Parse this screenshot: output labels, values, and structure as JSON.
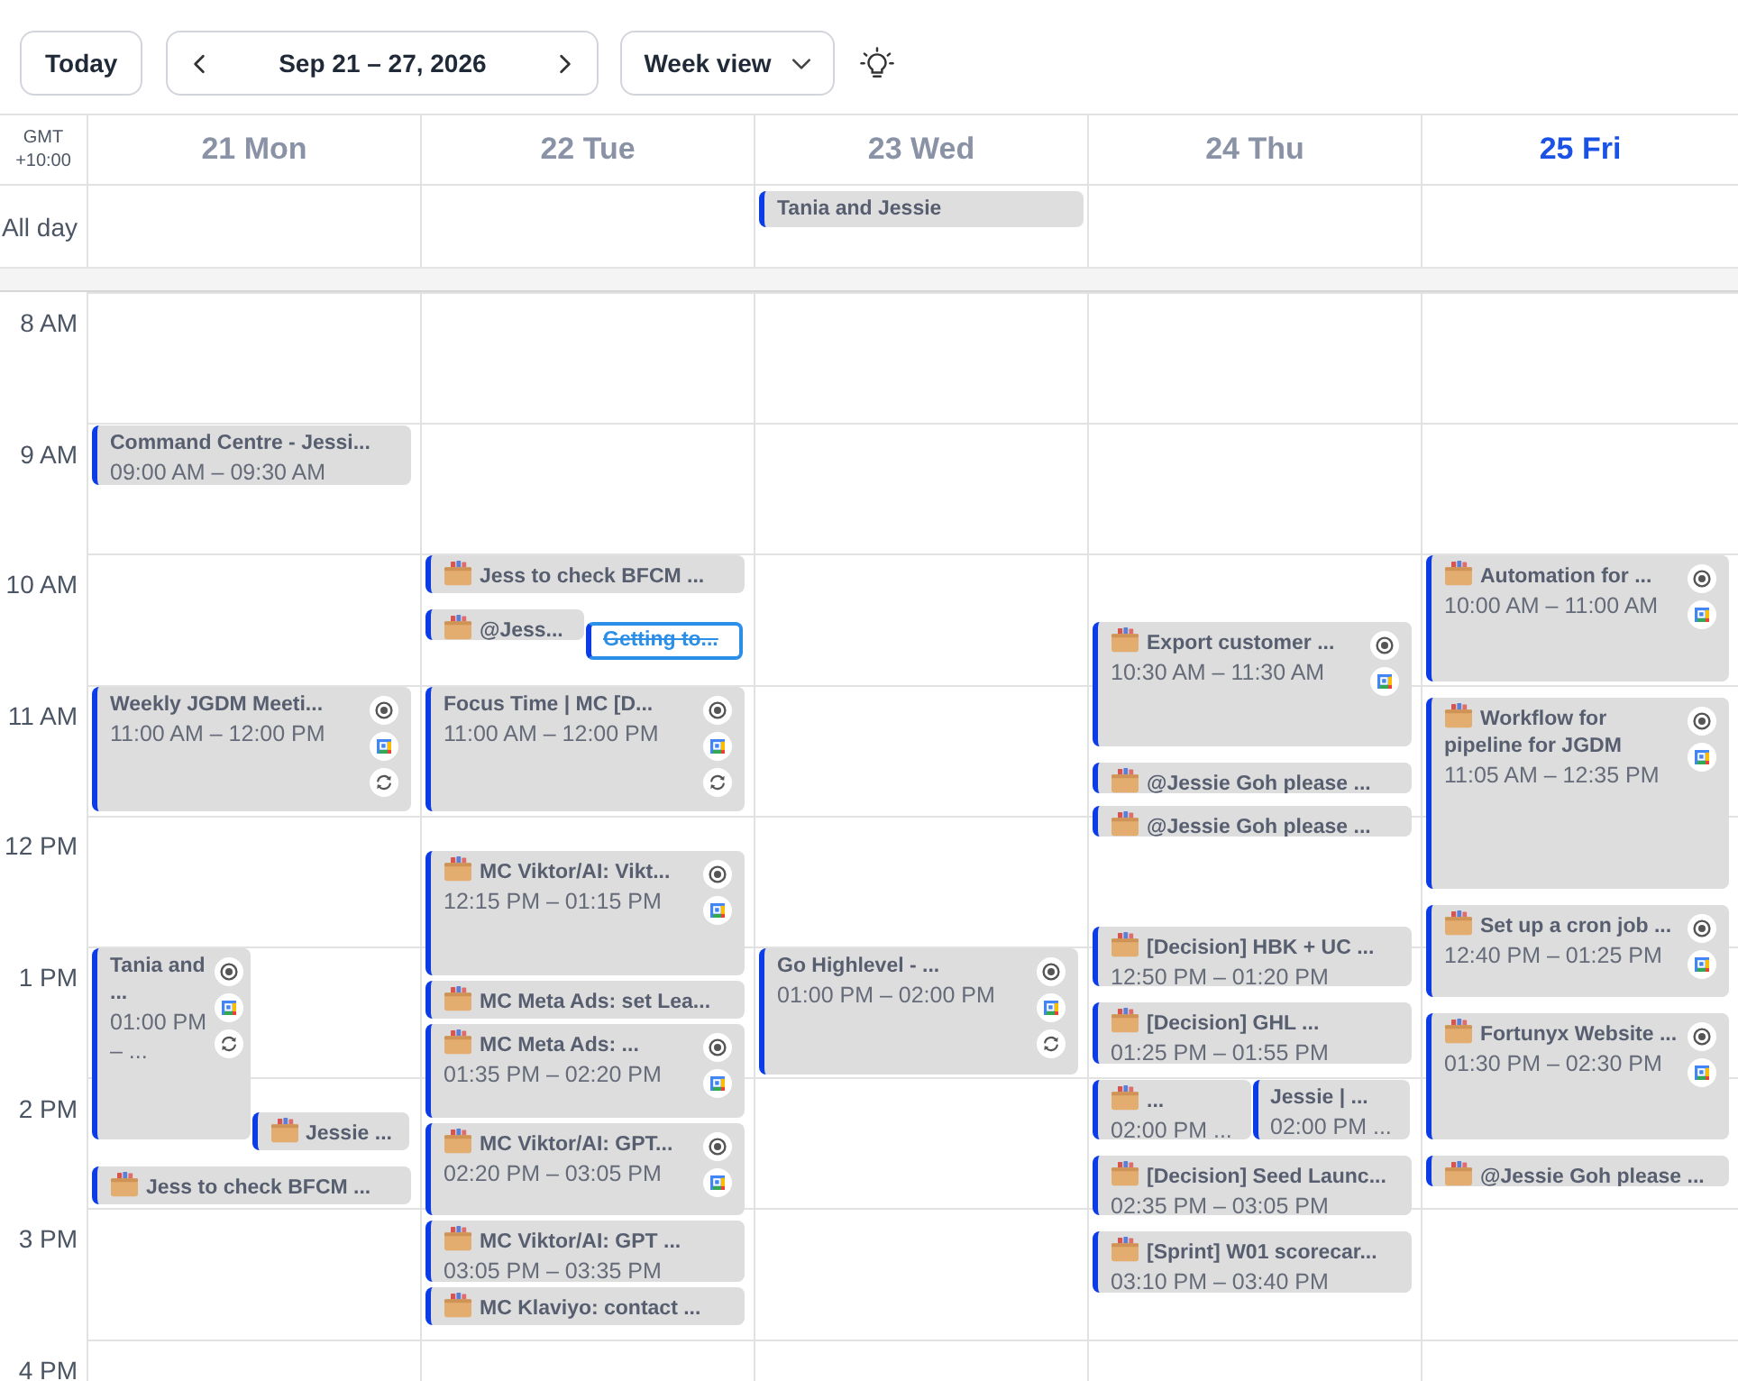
{
  "toolbar": {
    "today_button": "Today",
    "date_range": "Sep 21 – 27, 2026",
    "view_select": "Week view"
  },
  "timezone": "GMT +10:00",
  "all_day_label": "All day",
  "hours": [
    "8 AM",
    "9 AM",
    "10 AM",
    "11 AM",
    "12 PM",
    "1 PM",
    "2 PM",
    "3 PM",
    "4 PM"
  ],
  "days": [
    {
      "label": "21 Mon",
      "today": false,
      "events": [
        {
          "title": "Command Centre - Jessi...",
          "time": "09:00 AM – 09:30 AM",
          "box_icon": false,
          "status_icon": false,
          "calendar_icon": false,
          "repeat_icon": false,
          "done": false
        },
        {
          "title": "Weekly JGDM Meeti...",
          "time": "11:00 AM – 12:00 PM",
          "box_icon": false,
          "status_icon": true,
          "calendar_icon": true,
          "repeat_icon": true,
          "done": false
        },
        {
          "title": "Tania and ...",
          "time": "01:00 PM – ...",
          "box_icon": false,
          "status_icon": true,
          "calendar_icon": true,
          "repeat_icon": true,
          "done": false
        },
        {
          "title": "Jessie ...",
          "box_icon": true,
          "status_icon": false,
          "calendar_icon": false,
          "repeat_icon": false,
          "done": false
        },
        {
          "title": "Jess to check BFCM ...",
          "box_icon": true,
          "status_icon": false,
          "calendar_icon": false,
          "repeat_icon": false,
          "done": false
        }
      ]
    },
    {
      "label": "22 Tue",
      "today": false,
      "events": [
        {
          "title": "Jess to check BFCM ...",
          "box_icon": true,
          "status_icon": false,
          "calendar_icon": false,
          "repeat_icon": false,
          "done": false
        },
        {
          "title": "@Jess...",
          "box_icon": true,
          "status_icon": false,
          "calendar_icon": false,
          "repeat_icon": false,
          "done": false
        },
        {
          "title": "Getting to...",
          "box_icon": false,
          "status_icon": false,
          "calendar_icon": false,
          "repeat_icon": false,
          "done": true
        },
        {
          "title": "Focus Time | MC [D...",
          "time": "11:00 AM – 12:00 PM",
          "box_icon": false,
          "status_icon": true,
          "calendar_icon": true,
          "repeat_icon": true,
          "done": false
        },
        {
          "title": "MC Viktor/AI: Vikt...",
          "time": "12:15 PM – 01:15 PM",
          "box_icon": true,
          "status_icon": true,
          "calendar_icon": true,
          "repeat_icon": false,
          "done": false
        },
        {
          "title": "MC Meta Ads: set Lea...",
          "box_icon": true,
          "status_icon": false,
          "calendar_icon": false,
          "repeat_icon": false,
          "done": false
        },
        {
          "title": "MC Meta Ads: ...",
          "time": "01:35 PM – 02:20 PM",
          "box_icon": true,
          "status_icon": true,
          "calendar_icon": true,
          "repeat_icon": false,
          "done": false
        },
        {
          "title": "MC Viktor/AI: GPT...",
          "time": "02:20 PM – 03:05 PM",
          "box_icon": true,
          "status_icon": true,
          "calendar_icon": true,
          "repeat_icon": false,
          "done": false
        },
        {
          "title": "MC Viktor/AI: GPT ...",
          "time": "03:05 PM – 03:35 PM",
          "box_icon": true,
          "status_icon": false,
          "calendar_icon": false,
          "repeat_icon": false,
          "done": false
        },
        {
          "title": "MC Klaviyo: contact ...",
          "box_icon": true,
          "status_icon": false,
          "calendar_icon": false,
          "repeat_icon": false,
          "done": false
        }
      ]
    },
    {
      "label": "23 Wed",
      "today": false,
      "all_day": [
        {
          "title": "Tania and Jessie"
        }
      ],
      "events": [
        {
          "title": "Go Highlevel - ...",
          "time": "01:00 PM – 02:00 PM",
          "box_icon": false,
          "status_icon": true,
          "calendar_icon": true,
          "repeat_icon": true,
          "done": false
        }
      ]
    },
    {
      "label": "24 Thu",
      "today": false,
      "events": [
        {
          "title": "Export customer ...",
          "time": "10:30 AM – 11:30 AM",
          "box_icon": true,
          "status_icon": true,
          "calendar_icon": true,
          "repeat_icon": false,
          "done": false
        },
        {
          "title": "@Jessie Goh please ...",
          "box_icon": true,
          "status_icon": false,
          "calendar_icon": false,
          "repeat_icon": false,
          "done": false
        },
        {
          "title": "@Jessie Goh please ...",
          "box_icon": true,
          "status_icon": false,
          "calendar_icon": false,
          "repeat_icon": false,
          "done": false
        },
        {
          "title": "[Decision] HBK + UC ...",
          "time": "12:50 PM – 01:20 PM",
          "box_icon": true,
          "status_icon": false,
          "calendar_icon": false,
          "repeat_icon": false,
          "done": false
        },
        {
          "title": "[Decision] GHL ...",
          "time": "01:25 PM – 01:55 PM",
          "box_icon": true,
          "status_icon": false,
          "calendar_icon": false,
          "repeat_icon": false,
          "done": false
        },
        {
          "title": "...",
          "time": "02:00 PM ...",
          "box_icon": true,
          "status_icon": false,
          "calendar_icon": false,
          "repeat_icon": false,
          "done": false
        },
        {
          "title": "Jessie | ...",
          "time": "02:00 PM ...",
          "box_icon": false,
          "status_icon": false,
          "calendar_icon": false,
          "repeat_icon": false,
          "done": false
        },
        {
          "title": "[Decision] Seed Launc...",
          "time": "02:35 PM – 03:05 PM",
          "box_icon": true,
          "status_icon": false,
          "calendar_icon": false,
          "repeat_icon": false,
          "done": false
        },
        {
          "title": "[Sprint] W01 scorecar...",
          "time": "03:10 PM – 03:40 PM",
          "box_icon": true,
          "status_icon": false,
          "calendar_icon": false,
          "repeat_icon": false,
          "done": false
        }
      ]
    },
    {
      "label": "25 Fri",
      "today": true,
      "events": [
        {
          "title": "Automation for ...",
          "time": "10:00 AM – 11:00 AM",
          "box_icon": true,
          "status_icon": true,
          "calendar_icon": true,
          "repeat_icon": false,
          "done": false
        },
        {
          "title": "Workflow for pipeline for JGDM",
          "time": "11:05 AM – 12:35 PM",
          "box_icon": true,
          "status_icon": true,
          "calendar_icon": true,
          "repeat_icon": false,
          "done": false
        },
        {
          "title": "Set up a cron job ...",
          "time": "12:40 PM – 01:25 PM",
          "box_icon": true,
          "status_icon": true,
          "calendar_icon": true,
          "repeat_icon": false,
          "done": false
        },
        {
          "title": "Fortunyx Website ...",
          "time": "01:30 PM – 02:30 PM",
          "box_icon": true,
          "status_icon": true,
          "calendar_icon": true,
          "repeat_icon": false,
          "done": false
        },
        {
          "title": "@Jessie Goh please ...",
          "box_icon": true,
          "status_icon": false,
          "calendar_icon": false,
          "repeat_icon": false,
          "done": false
        }
      ]
    }
  ]
}
